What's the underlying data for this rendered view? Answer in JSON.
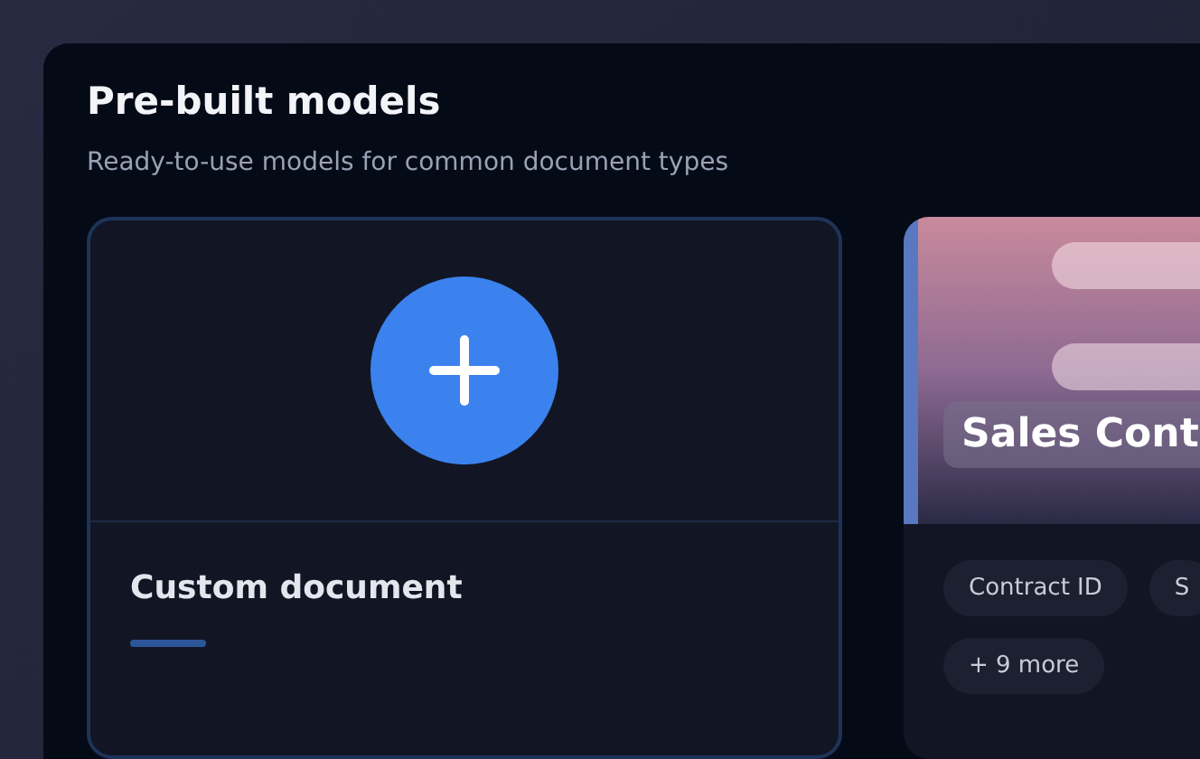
{
  "section": {
    "title": "Pre-built models",
    "subtitle": "Ready-to-use models for common document types"
  },
  "cards": [
    {
      "kind": "custom",
      "title": "Custom document"
    },
    {
      "kind": "model",
      "title": "Sales Cont",
      "fields": [
        "Contract ID",
        "S"
      ],
      "more": "+ 9 more"
    }
  ]
}
